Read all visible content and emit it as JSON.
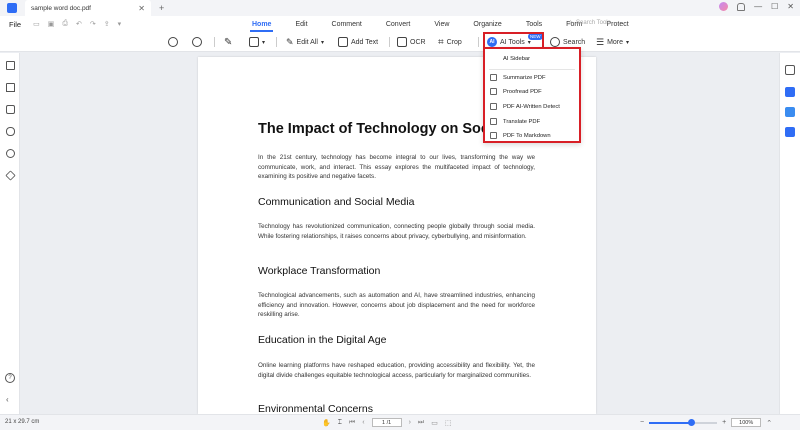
{
  "titlebar": {
    "tab_title": "sample word doc.pdf",
    "close": "✕",
    "add": "+"
  },
  "window": {
    "minimize": "—",
    "maximize": "☐",
    "close": "✕"
  },
  "menubar": {
    "file": "File",
    "tabs": [
      "Home",
      "Edit",
      "Comment",
      "Convert",
      "View",
      "Organize",
      "Tools",
      "Form",
      "Protect"
    ],
    "active_tab": "Home",
    "search_placeholder": "Search Tools"
  },
  "toolbar": {
    "edit_all": "Edit All",
    "add_text": "Add Text",
    "ocr": "OCR",
    "crop": "Crop",
    "ai_tools": "AI Tools",
    "ai_badge": "AI",
    "new_tag": "NEW",
    "search": "Search",
    "more": "More"
  },
  "ai_menu": {
    "items": [
      "AI Sidebar",
      "Summarize PDF",
      "Proofread PDF",
      "PDF AI-Written Detect",
      "Translate PDF",
      "PDF To Markdown"
    ]
  },
  "document": {
    "title": "The Impact of Technology on Soci",
    "intro": "In the 21st century, technology has become integral to our lives, transforming the way we communicate, work, and interact. This essay explores the multifaceted impact of technology, examining its positive and negative facets.",
    "sections": [
      {
        "heading": "Communication and Social Media",
        "body": "Technology has revolutionized communication, connecting people globally through social media. While fostering relationships, it raises concerns about privacy, cyberbullying, and misinformation."
      },
      {
        "heading": "Workplace Transformation",
        "body": "Technological advancements, such as automation and AI, have streamlined industries, enhancing efficiency and innovation. However, concerns about job displacement and the need for workforce reskilling arise."
      },
      {
        "heading": "Education in the Digital Age",
        "body": "Online learning platforms have reshaped education, providing accessibility and flexibility. Yet, the digital divide challenges equitable technological access, particularly for marginalized communities."
      },
      {
        "heading": "Environmental Concerns",
        "body": ""
      }
    ]
  },
  "statusbar": {
    "page_size": "21 x 29.7 cm",
    "page_indicator": "1 /1",
    "zoom_value": "100%",
    "zoom_level": 0.62
  },
  "colors": {
    "accent": "#2f6df5",
    "highlight": "#d81f26"
  }
}
